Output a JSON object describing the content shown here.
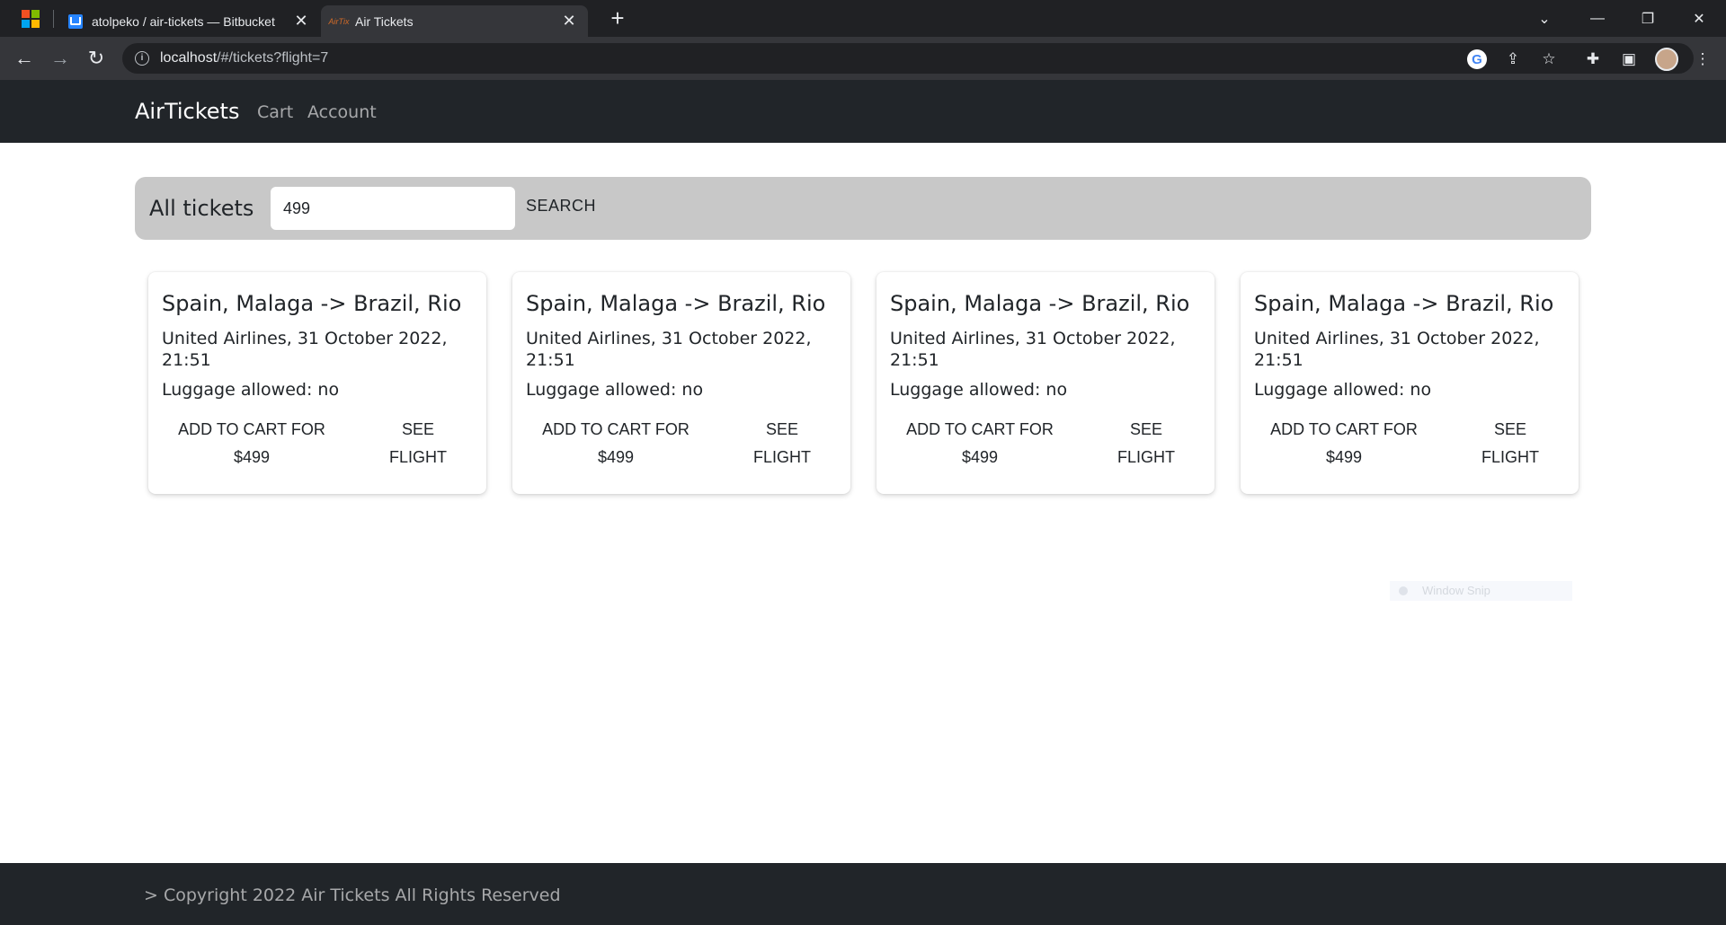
{
  "browser": {
    "tabs": [
      {
        "title": "atolpeko / air-tickets — Bitbucket",
        "active": false,
        "favicon": "bitbucket-icon"
      },
      {
        "title": "Air Tickets",
        "active": true,
        "favicon": "airtickets-icon"
      }
    ],
    "favicon_text": "AirTix",
    "url_host": "localhost",
    "url_path": "/#/tickets?flight=7",
    "colors": {
      "tabstrip": "#202124",
      "toolbar": "#35363a"
    }
  },
  "app": {
    "brand": "AirTickets",
    "nav": {
      "cart": "Cart",
      "account": "Account"
    },
    "search": {
      "title": "All tickets",
      "value": "499",
      "button": "SEARCH"
    },
    "cards": [
      {
        "route": "Spain, Malaga -> Brazil, Rio",
        "info": "United Airlines, 31 October 2022, 21:51",
        "luggage": "Luggage allowed: no",
        "add_to_cart": "ADD TO CART FOR $499",
        "see_flight": "SEE FLIGHT"
      },
      {
        "route": "Spain, Malaga -> Brazil, Rio",
        "info": "United Airlines, 31 October 2022, 21:51",
        "luggage": "Luggage allowed: no",
        "add_to_cart": "ADD TO CART FOR $499",
        "see_flight": "SEE FLIGHT"
      },
      {
        "route": "Spain, Malaga -> Brazil, Rio",
        "info": "United Airlines, 31 October 2022, 21:51",
        "luggage": "Luggage allowed: no",
        "add_to_cart": "ADD TO CART FOR $499",
        "see_flight": "SEE FLIGHT"
      },
      {
        "route": "Spain, Malaga -> Brazil, Rio",
        "info": "United Airlines, 31 October 2022, 21:51",
        "luggage": "Luggage allowed: no",
        "add_to_cart": "ADD TO CART FOR $499",
        "see_flight": "SEE FLIGHT"
      }
    ],
    "overlay": "Window Snip",
    "footer": "> Copyright 2022 Air Tickets All Rights Reserved",
    "colors": {
      "navbar": "#212529",
      "searchbar": "#c8c8c8",
      "footer": "#212529"
    }
  }
}
